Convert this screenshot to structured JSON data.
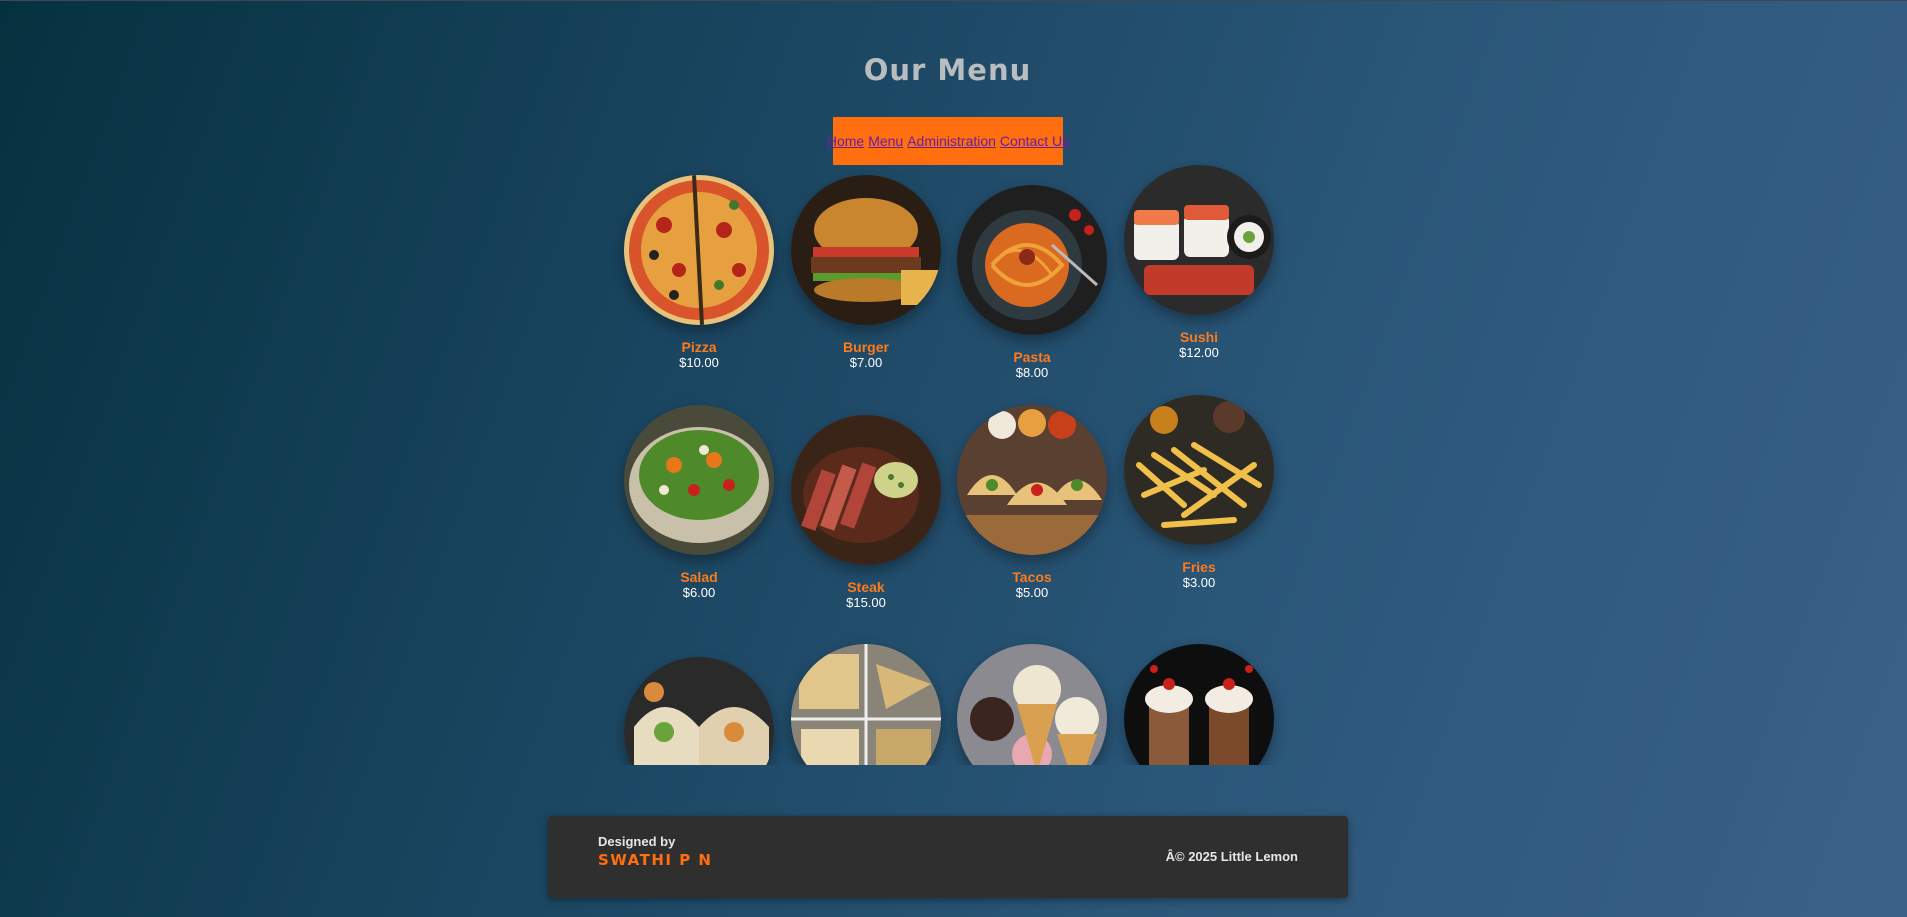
{
  "page": {
    "title": "Our Menu"
  },
  "nav": {
    "items": [
      {
        "label": "Home"
      },
      {
        "label": "Menu"
      },
      {
        "label": "Administration"
      },
      {
        "label": "Contact Us"
      }
    ]
  },
  "menu": {
    "items": [
      {
        "name": "Pizza",
        "price": "$10.00",
        "icon": "pizza-image"
      },
      {
        "name": "Burger",
        "price": "$7.00",
        "icon": "burger-image"
      },
      {
        "name": "Pasta",
        "price": "$8.00",
        "icon": "pasta-image"
      },
      {
        "name": "Sushi",
        "price": "$12.00",
        "icon": "sushi-image"
      },
      {
        "name": "Salad",
        "price": "$6.00",
        "icon": "salad-image"
      },
      {
        "name": "Steak",
        "price": "$15.00",
        "icon": "steak-image"
      },
      {
        "name": "Tacos",
        "price": "$5.00",
        "icon": "tacos-image"
      },
      {
        "name": "Fries",
        "price": "$3.00",
        "icon": "fries-image"
      },
      {
        "icon": "wrap-image"
      },
      {
        "icon": "sandwich-image"
      },
      {
        "icon": "ice-cream-image"
      },
      {
        "icon": "milkshake-image"
      }
    ]
  },
  "footer": {
    "designed_by_label": "Designed by",
    "designer_name": "SWATHI P N",
    "copyright": "Â© 2025 Little Lemon"
  },
  "colors": {
    "accent": "#ff6f0f",
    "nav_link": "#6a1fa0",
    "footer_bg": "#2f2f2f"
  }
}
